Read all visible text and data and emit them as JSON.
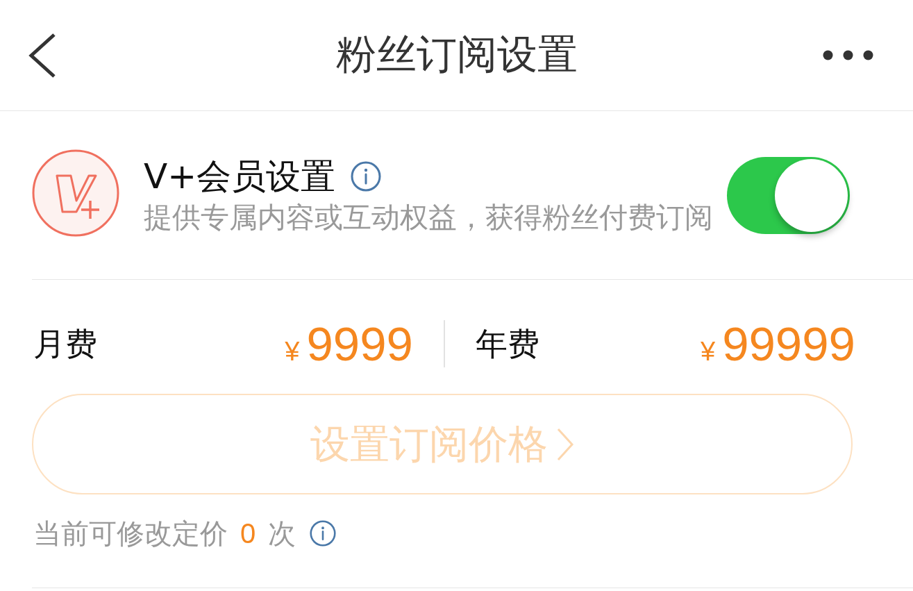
{
  "header": {
    "title": "粉丝订阅设置"
  },
  "membership": {
    "title": "V+会员设置",
    "description": "提供专属内容或互动权益，获得粉丝付费订阅",
    "on": true
  },
  "prices": [
    {
      "label": "月费",
      "currency": "¥",
      "amount": "9999"
    },
    {
      "label": "年费",
      "currency": "¥",
      "amount": "99999"
    }
  ],
  "set_price_button": {
    "label": "设置订阅价格",
    "disabled": true
  },
  "edit_count": {
    "prefix": "当前可修改定价",
    "count": "0",
    "suffix": "次"
  }
}
